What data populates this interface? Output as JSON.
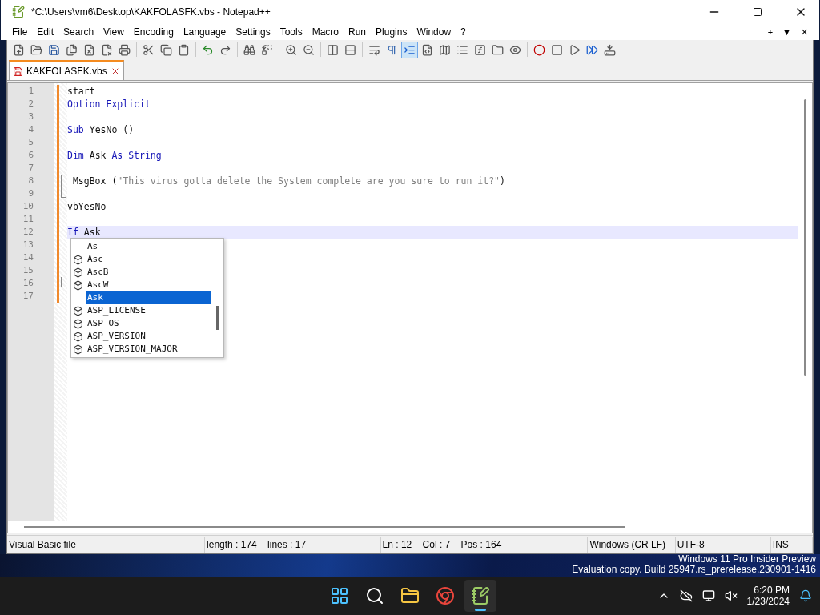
{
  "window": {
    "title": "*C:\\Users\\vm6\\Desktop\\KAKFOLASFK.vbs - Notepad++",
    "menu": [
      "File",
      "Edit",
      "Search",
      "View",
      "Encoding",
      "Language",
      "Settings",
      "Tools",
      "Macro",
      "Run",
      "Plugins",
      "Window",
      "?"
    ],
    "menu_right": [
      "+",
      "▼",
      "✕"
    ]
  },
  "toolbar": [
    {
      "kind": "new",
      "selected": false
    },
    {
      "kind": "open",
      "selected": false
    },
    {
      "kind": "save",
      "selected": false
    },
    {
      "kind": "save-all",
      "selected": false
    },
    {
      "kind": "close",
      "selected": false
    },
    {
      "kind": "close-all",
      "selected": false
    },
    {
      "kind": "print",
      "selected": false
    },
    {
      "kind": "sep"
    },
    {
      "kind": "cut",
      "selected": false
    },
    {
      "kind": "copy",
      "selected": false
    },
    {
      "kind": "paste",
      "selected": false
    },
    {
      "kind": "sep"
    },
    {
      "kind": "undo",
      "selected": false
    },
    {
      "kind": "redo",
      "selected": false
    },
    {
      "kind": "sep"
    },
    {
      "kind": "find",
      "selected": false
    },
    {
      "kind": "replace",
      "selected": false
    },
    {
      "kind": "sep"
    },
    {
      "kind": "zoom-in",
      "selected": false
    },
    {
      "kind": "zoom-out",
      "selected": false
    },
    {
      "kind": "sep"
    },
    {
      "kind": "sync-v",
      "selected": false
    },
    {
      "kind": "sync-h",
      "selected": false
    },
    {
      "kind": "sep"
    },
    {
      "kind": "wrap",
      "selected": false
    },
    {
      "kind": "pilcrow",
      "selected": false
    },
    {
      "kind": "indent",
      "selected": true
    },
    {
      "kind": "lang",
      "selected": false
    },
    {
      "kind": "map",
      "selected": false
    },
    {
      "kind": "list",
      "selected": false
    },
    {
      "kind": "func",
      "selected": false
    },
    {
      "kind": "folder",
      "selected": false
    },
    {
      "kind": "eye",
      "selected": false
    },
    {
      "kind": "sep"
    },
    {
      "kind": "record",
      "selected": false
    },
    {
      "kind": "stop",
      "selected": false
    },
    {
      "kind": "play",
      "selected": false
    },
    {
      "kind": "play-multi",
      "selected": false
    },
    {
      "kind": "save-macro",
      "selected": false
    }
  ],
  "tabs": [
    {
      "label": "KAKFOLASFK.vbs",
      "selected": true
    }
  ],
  "editor": {
    "lines": [
      {
        "number": "1",
        "tokens": [
          {
            "kind": "plain",
            "text": "start"
          }
        ]
      },
      {
        "number": "2",
        "tokens": [
          {
            "kind": "keyword",
            "text": "Option Explicit"
          }
        ]
      },
      {
        "number": "3"
      },
      {
        "number": "4",
        "tokens": [
          {
            "kind": "keyword",
            "text": "Sub"
          },
          {
            "kind": "plain",
            "text": " YesNo ()"
          }
        ]
      },
      {
        "number": "5"
      },
      {
        "number": "6",
        "tokens": [
          {
            "kind": "keyword",
            "text": "Dim"
          },
          {
            "kind": "plain",
            "text": " Ask "
          },
          {
            "kind": "keyword",
            "text": "As String"
          }
        ]
      },
      {
        "number": "7"
      },
      {
        "number": "8",
        "fold_start": true,
        "tokens": [
          {
            "kind": "plain",
            "text": " MsgBox ("
          },
          {
            "kind": "string",
            "text": "\"This virus gotta delete the System complete are you sure to run it?\""
          },
          {
            "kind": "plain",
            "text": ")"
          }
        ]
      },
      {
        "number": "9",
        "fold_end": true
      },
      {
        "number": "10",
        "tokens": [
          {
            "kind": "plain",
            "text": "vbYesNo"
          }
        ]
      },
      {
        "number": "11"
      },
      {
        "number": "12",
        "current": true,
        "tokens": [
          {
            "kind": "keyword",
            "text": "If"
          },
          {
            "kind": "plain",
            "text": " Ask"
          }
        ]
      },
      {
        "number": "13"
      },
      {
        "number": "14"
      },
      {
        "number": "15"
      },
      {
        "number": "16",
        "fold_end": true
      },
      {
        "number": "17"
      }
    ],
    "autocomplete": [
      {
        "kind": "word",
        "text": "As",
        "selected": false
      },
      {
        "kind": "function",
        "text": "Asc",
        "selected": false
      },
      {
        "kind": "function",
        "text": "AscB",
        "selected": false
      },
      {
        "kind": "function",
        "text": "AscW",
        "selected": false
      },
      {
        "kind": "word",
        "text": "Ask",
        "selected": true
      },
      {
        "kind": "function",
        "text": "ASP_LICENSE",
        "selected": false
      },
      {
        "kind": "function",
        "text": "ASP_OS",
        "selected": false
      },
      {
        "kind": "function",
        "text": "ASP_VERSION",
        "selected": false
      },
      {
        "kind": "function",
        "text": "ASP_VERSION_MAJOR",
        "selected": false
      }
    ]
  },
  "status_bar": [
    "Visual Basic file",
    "length : 174    lines : 17",
    "Ln : 12    Col : 7    Pos : 164",
    "Windows (CR LF)",
    "UTF-8",
    "INS"
  ],
  "desktop_text": [
    "Windows 11 Pro Insider Preview",
    "Evaluation copy. Build 25947.rs_prerelease.230901-1416"
  ],
  "taskbar": {
    "apps": [
      {
        "kind": "start",
        "selected": false
      },
      {
        "kind": "search",
        "selected": false
      },
      {
        "kind": "explorer",
        "selected": false
      },
      {
        "kind": "chrome",
        "selected": false
      },
      {
        "kind": "notepad",
        "selected": true
      }
    ],
    "time": "6:20 PM",
    "date": "1/23/2024"
  }
}
